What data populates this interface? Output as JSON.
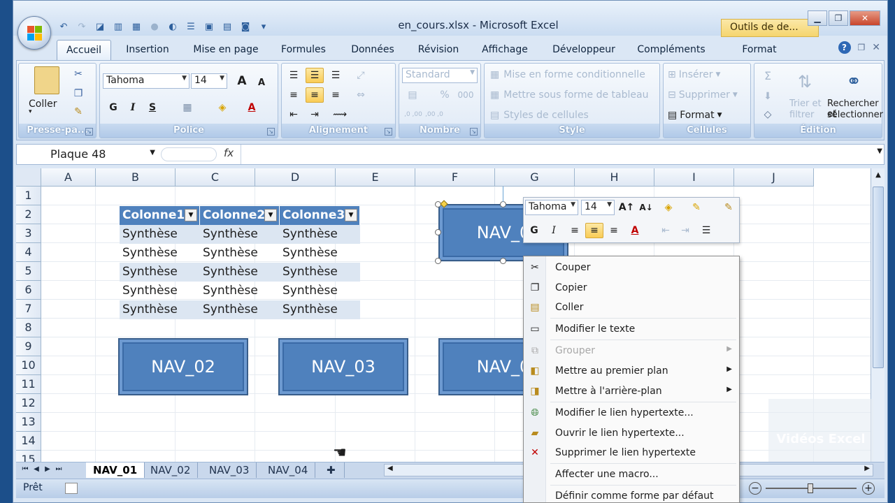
{
  "window": {
    "title": "en_cours.xlsx - Microsoft Excel",
    "tools_title": "Outils de de...",
    "controls": [
      "minimize",
      "restore",
      "close"
    ]
  },
  "quick_access": [
    "undo-icon",
    "redo-icon",
    "camera-icon",
    "save-icon",
    "folder-icon"
  ],
  "tabs": [
    {
      "label": "Accueil",
      "active": true
    },
    {
      "label": "Insertion"
    },
    {
      "label": "Mise en page"
    },
    {
      "label": "Formules"
    },
    {
      "label": "Données"
    },
    {
      "label": "Révision"
    },
    {
      "label": "Affichage"
    },
    {
      "label": "Développeur"
    },
    {
      "label": "Compléments"
    },
    {
      "label": "Format"
    }
  ],
  "ribbon": {
    "clipboard": {
      "label": "Presse-pa...",
      "paste": "Coller"
    },
    "font": {
      "label": "Police",
      "name": "Tahoma",
      "size": "14",
      "bold": "G",
      "italic": "I",
      "underline": "S",
      "grow": "A",
      "shrink": "A",
      "color": "A"
    },
    "alignment": {
      "label": "Alignement"
    },
    "number": {
      "label": "Nombre",
      "format": "Standard",
      "percent": "%",
      "thousands": "000",
      "inc": ",0 ,00",
      "dec": ",00 ,0"
    },
    "style": {
      "label": "Style",
      "conditional": "Mise en forme conditionnelle",
      "table": "Mettre sous forme de tableau",
      "cell_styles": "Styles de cellules"
    },
    "cells": {
      "label": "Cellules",
      "insert": "Insérer",
      "delete": "Supprimer",
      "format": "Format"
    },
    "editing": {
      "label": "Édition",
      "sort1": "Trier et",
      "sort2": "filtrer",
      "find1": "Rechercher et",
      "find2": "sélectionner"
    }
  },
  "formula_bar": {
    "name_box": "Plaque 48",
    "fx": "fx",
    "value": ""
  },
  "grid": {
    "columns": [
      "A",
      "B",
      "C",
      "D",
      "E",
      "F",
      "G",
      "H",
      "I",
      "J"
    ],
    "rows": [
      "1",
      "2",
      "3",
      "4",
      "5",
      "6",
      "7",
      "8",
      "9",
      "10",
      "11",
      "12",
      "13",
      "14",
      "15"
    ],
    "table": {
      "headers": [
        "Colonne1",
        "Colonne2",
        "Colonne3"
      ],
      "rows": [
        [
          "Synthèse",
          "Synthèse",
          "Synthèse"
        ],
        [
          "Synthèse",
          "Synthèse",
          "Synthèse"
        ],
        [
          "Synthèse",
          "Synthèse",
          "Synthèse"
        ],
        [
          "Synthèse",
          "Synthèse",
          "Synthèse"
        ],
        [
          "Synthèse",
          "Synthèse",
          "Synthèse"
        ]
      ]
    },
    "shapes": [
      "NAV_0",
      "NAV_02",
      "NAV_03",
      "NAV_0"
    ]
  },
  "mini_toolbar": {
    "font": "Tahoma",
    "size": "14",
    "bold": "G",
    "italic": "I",
    "color": "A"
  },
  "context_menu": [
    {
      "label": "Couper",
      "icon": "scissors-icon"
    },
    {
      "label": "Copier",
      "icon": "copy-icon"
    },
    {
      "label": "Coller",
      "icon": "paste-icon"
    },
    {
      "label": "Modifier le texte",
      "icon": "edit-text-icon"
    },
    {
      "label": "Grouper",
      "icon": "group-icon",
      "disabled": true,
      "submenu": true
    },
    {
      "label": "Mettre au premier plan",
      "icon": "bring-front-icon",
      "submenu": true
    },
    {
      "label": "Mettre à l'arrière-plan",
      "icon": "send-back-icon",
      "submenu": true
    },
    {
      "label": "Modifier le lien hypertexte...",
      "icon": "hyperlink-edit-icon"
    },
    {
      "label": "Ouvrir le lien hypertexte...",
      "icon": "hyperlink-open-icon"
    },
    {
      "label": "Supprimer le lien hypertexte",
      "icon": "hyperlink-remove-icon"
    },
    {
      "label": "Affecter une macro..."
    },
    {
      "label": "Définir comme forme par défaut"
    }
  ],
  "sheets": [
    "NAV_01",
    "NAV_02",
    "NAV_03",
    "NAV_04"
  ],
  "active_sheet": "NAV_01",
  "status": {
    "ready": "Prêt"
  },
  "watermark": "Vidéos Excel"
}
